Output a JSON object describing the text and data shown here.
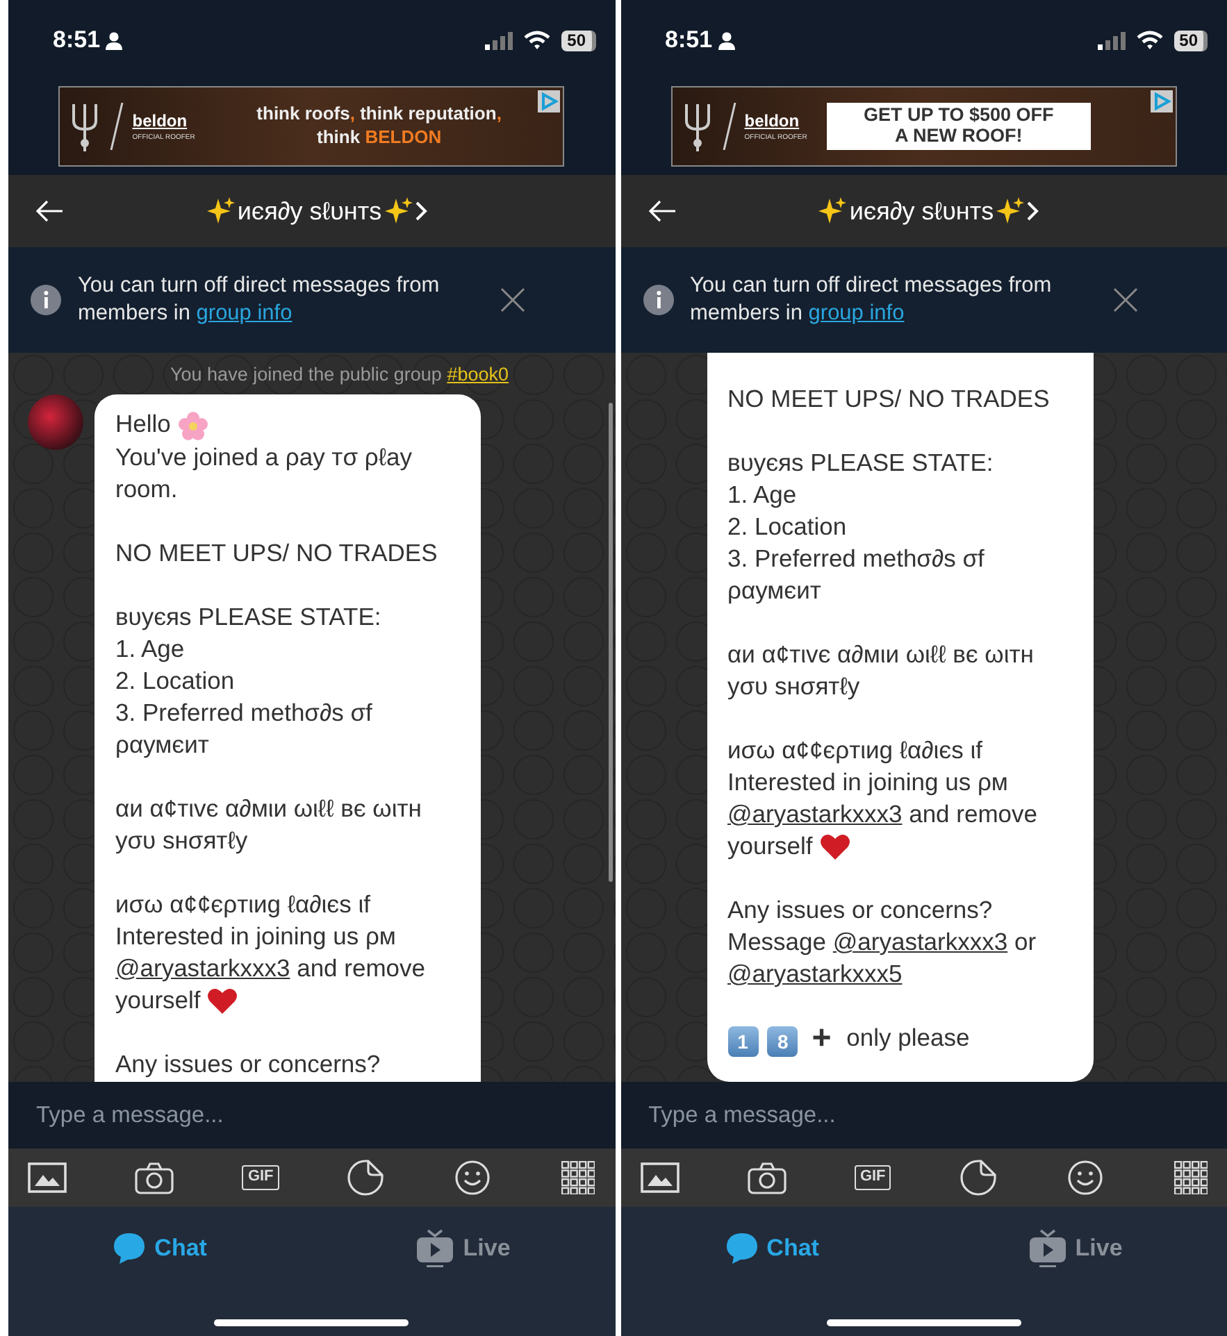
{
  "screens": [
    {
      "status_bar": {
        "time": "8:51",
        "battery": "50"
      },
      "ad": {
        "logo": "beldon",
        "tagline": "OFFICIAL ROOFER",
        "kind": "slogan",
        "lines": [
          {
            "parts": [
              {
                "text": "think roofs",
                "accent": false
              },
              {
                "text": ",",
                "accent": true
              },
              {
                "text": " think reputation",
                "accent": false
              },
              {
                "text": ",",
                "accent": true
              }
            ]
          },
          {
            "parts": [
              {
                "text": "think ",
                "accent": false
              },
              {
                "text": "BELDON",
                "accent": true
              }
            ]
          }
        ]
      },
      "header": {
        "title": "иєя∂у ѕℓυнтѕ"
      },
      "notice": {
        "text": "You can turn off direct messages from members in",
        "link": "group info"
      },
      "chat": {
        "system": {
          "text": "You have joined the public group",
          "link": "#book0"
        },
        "avatar": true,
        "scrollbar": true,
        "paragraphs": [
          [
            [
              {
                "kind": "text",
                "text": "Hello"
              },
              {
                "kind": "flower"
              }
            ],
            [
              {
                "kind": "text",
                "text": "You've joined a ρay тσ ρℓay room."
              }
            ]
          ],
          [
            [
              {
                "kind": "text",
                "text": "NO MEET UPS/ NO TRADES"
              }
            ]
          ],
          [
            [
              {
                "kind": "text",
                "text": "вυуєяѕ PLEASE STATE:"
              }
            ],
            [
              {
                "kind": "text",
                "text": "1. Age"
              }
            ],
            [
              {
                "kind": "text",
                "text": "2. Location"
              }
            ],
            [
              {
                "kind": "text",
                "text": "3. Preferred methσ∂s σf ραумєит"
              }
            ]
          ],
          [
            [
              {
                "kind": "text",
                "text": "αи α¢тιvє α∂мιи ωιℓℓ вє ωιтн уσυ ѕнσятℓу"
              }
            ]
          ],
          [
            [
              {
                "kind": "text",
                "text": "иσω α¢¢єρтιиg ℓα∂ιєѕ ιf"
              }
            ],
            [
              {
                "kind": "text",
                "text": "Interested in joining us ρм"
              },
              {
                "kind": "mention",
                "text": "@aryastarkxxx3"
              },
              {
                "kind": "text",
                "text": "and remove yourself"
              },
              {
                "kind": "heart"
              }
            ]
          ],
          [
            [
              {
                "kind": "text",
                "text": "Any issues or concerns?"
              }
            ]
          ]
        ]
      },
      "input": {
        "placeholder": "Type a message..."
      },
      "toolbar": [
        {
          "kind": "image"
        },
        {
          "kind": "camera"
        },
        {
          "kind": "gif",
          "text": "GIF"
        },
        {
          "kind": "sticker"
        },
        {
          "kind": "emoji"
        },
        {
          "kind": "grid"
        }
      ],
      "tabs": [
        {
          "kind": "chat",
          "label": "Chat",
          "selected": true
        },
        {
          "kind": "live",
          "label": "Live",
          "selected": false
        }
      ]
    },
    {
      "status_bar": {
        "time": "8:51",
        "battery": "50"
      },
      "ad": {
        "logo": "beldon",
        "tagline": "OFFICIAL ROOFER",
        "kind": "offer",
        "lines": [
          {
            "parts": [
              {
                "text": "GET UP TO $500 OFF",
                "accent": false
              }
            ]
          },
          {
            "parts": [
              {
                "text": "A NEW ROOF!",
                "accent": false
              }
            ]
          }
        ]
      },
      "header": {
        "title": "иєя∂у ѕℓυнтѕ"
      },
      "notice": {
        "text": "You can turn off direct messages from members in",
        "link": "group info"
      },
      "chat": {
        "avatar": false,
        "scrollbar": false,
        "paragraphs": [
          [
            [
              {
                "kind": "text",
                "text": "NO MEET UPS/ NO TRADES"
              }
            ]
          ],
          [
            [
              {
                "kind": "text",
                "text": "вυуєяѕ PLEASE STATE:"
              }
            ],
            [
              {
                "kind": "text",
                "text": "1. Age"
              }
            ],
            [
              {
                "kind": "text",
                "text": "2. Location"
              }
            ],
            [
              {
                "kind": "text",
                "text": "3. Preferred methσ∂s σf ραумєит"
              }
            ]
          ],
          [
            [
              {
                "kind": "text",
                "text": "αи α¢тιvє α∂мιи ωιℓℓ вє ωιтн уσυ ѕнσятℓу"
              }
            ]
          ],
          [
            [
              {
                "kind": "text",
                "text": "иσω α¢¢єρтιиg ℓα∂ιєѕ ιf"
              }
            ],
            [
              {
                "kind": "text",
                "text": "Interested in joining us ρм"
              },
              {
                "kind": "mention",
                "text": "@aryastarkxxx3"
              },
              {
                "kind": "text",
                "text": "and remove yourself"
              },
              {
                "kind": "heart"
              }
            ]
          ],
          [
            [
              {
                "kind": "text",
                "text": "Any issues or concerns?"
              }
            ],
            [
              {
                "kind": "text",
                "text": "Message"
              },
              {
                "kind": "mention",
                "text": "@aryastarkxxx3"
              },
              {
                "kind": "text",
                "text": "or"
              },
              {
                "kind": "mention",
                "text": "@aryastarkxxx5"
              }
            ]
          ],
          [
            [
              {
                "kind": "keycap",
                "text": "1"
              },
              {
                "kind": "keycap",
                "text": "8"
              },
              {
                "kind": "plus",
                "text": "+"
              },
              {
                "kind": "text",
                "text": "only please"
              }
            ]
          ]
        ]
      },
      "input": {
        "placeholder": "Type a message..."
      },
      "toolbar": [
        {
          "kind": "image"
        },
        {
          "kind": "camera"
        },
        {
          "kind": "gif",
          "text": "GIF"
        },
        {
          "kind": "sticker"
        },
        {
          "kind": "emoji"
        },
        {
          "kind": "grid"
        }
      ],
      "tabs": [
        {
          "kind": "chat",
          "label": "Chat",
          "selected": true
        },
        {
          "kind": "live",
          "label": "Live",
          "selected": false
        }
      ]
    }
  ]
}
